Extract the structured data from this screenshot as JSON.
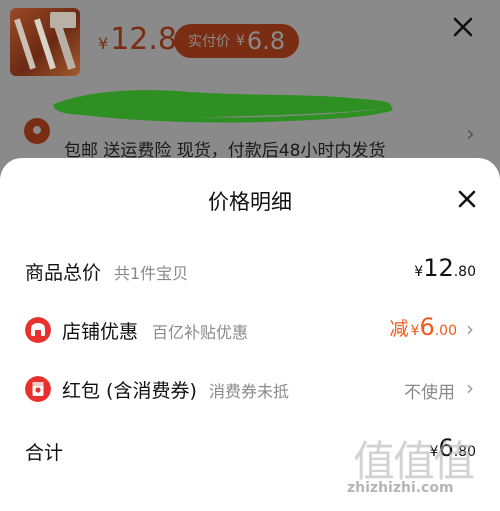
{
  "product": {
    "price_currency": "¥",
    "price": "12.8",
    "pay_label": "实付价",
    "pay_currency": "¥",
    "pay_price": "6.8",
    "shipping_text": "包邮  送运费险  现货，付款后48小时内发货"
  },
  "detail": {
    "title": "价格明细",
    "rows": [
      {
        "label": "商品总价",
        "sub": "共1件宝贝",
        "currency": "¥",
        "integer": "12",
        "decimal": ".80"
      },
      {
        "label": "店铺优惠",
        "sub": "百亿补贴优惠",
        "prefix": "减",
        "currency": "¥",
        "integer": "6",
        "decimal": ".00",
        "icon": "store-discount-icon"
      },
      {
        "label": "红包 (含消费券)",
        "sub": "消费券未抵",
        "value": "不使用",
        "icon": "red-packet-icon"
      },
      {
        "label": "合计",
        "currency": "¥",
        "integer": "6",
        "decimal": ".80"
      }
    ]
  },
  "watermark": {
    "mark": "值值值",
    "domain": "zhizhizhi.com"
  },
  "colors": {
    "accent": "#f05a1a",
    "icon_red": "#e8312e",
    "text_muted": "#8a8a8a",
    "overlay": "#8a8a8a"
  }
}
